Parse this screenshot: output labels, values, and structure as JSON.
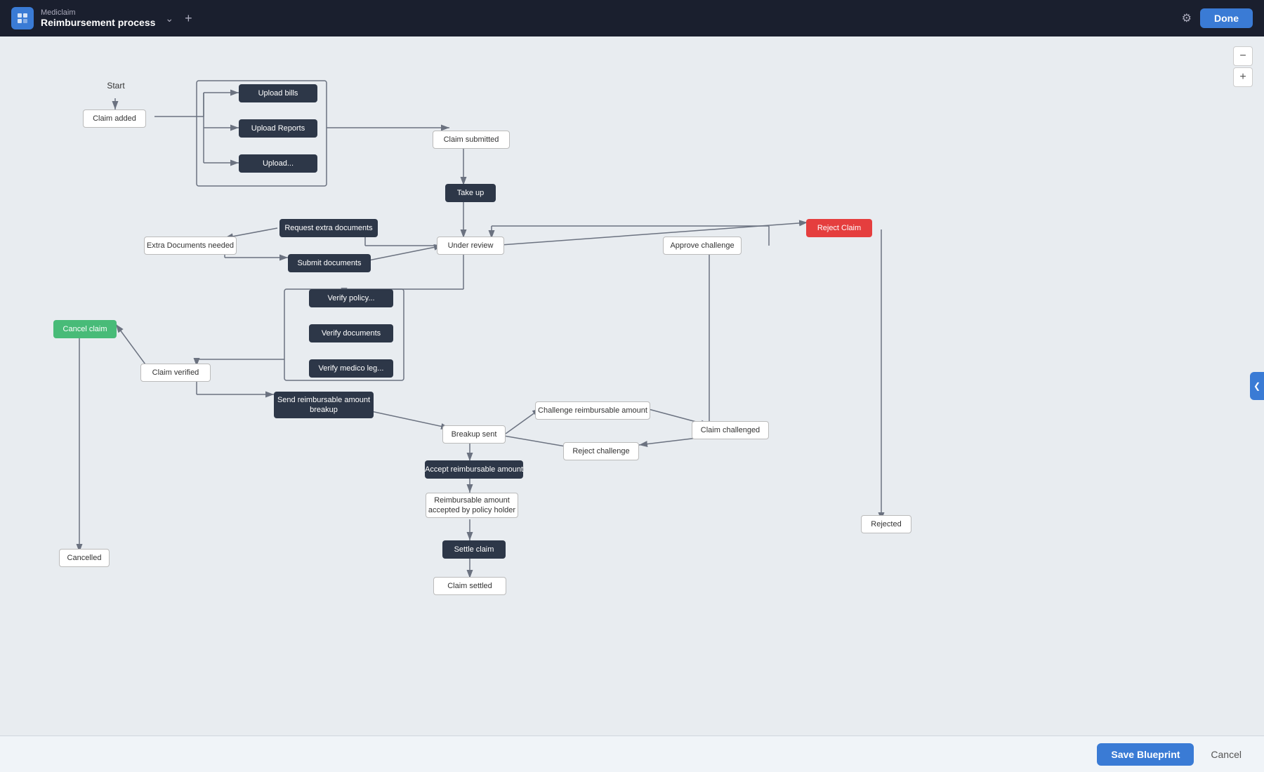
{
  "header": {
    "app_name": "Mediclaim",
    "process_name": "Reimbursement process",
    "done_label": "Done"
  },
  "footer": {
    "save_label": "Save Blueprint",
    "cancel_label": "Cancel"
  },
  "zoom": {
    "minus": "−",
    "plus": "+"
  },
  "nodes": {
    "start": "Start",
    "claim_added": "Claim added",
    "upload_bills": "Upload bills",
    "upload_reports": "Upload Reports",
    "upload_other": "Upload...",
    "claim_submitted": "Claim submitted",
    "take_up": "Take up",
    "under_review": "Under review",
    "request_extra": "Request extra documents",
    "extra_docs_needed": "Extra Documents needed",
    "submit_documents": "Submit documents",
    "verify_policy": "Verify policy...",
    "verify_documents": "Verify documents",
    "verify_medico": "Verify medico leg...",
    "claim_verified": "Claim verified",
    "cancel_claim": "Cancel claim",
    "send_breakup": "Send reimbursable amount breakup",
    "breakup_sent": "Breakup sent",
    "challenge_amount": "Challenge reimbursable amount",
    "claim_challenged": "Claim challenged",
    "reject_challenge": "Reject challenge",
    "approve_challenge": "Approve challenge",
    "accept_reimbursable": "Accept reimbursable amount",
    "reimbursable_accepted": "Reimbursable amount accepted by policy holder",
    "settle_claim": "Settle claim",
    "claim_settled": "Claim settled",
    "reject_claim": "Reject Claim",
    "rejected": "Rejected",
    "cancelled": "Cancelled"
  }
}
